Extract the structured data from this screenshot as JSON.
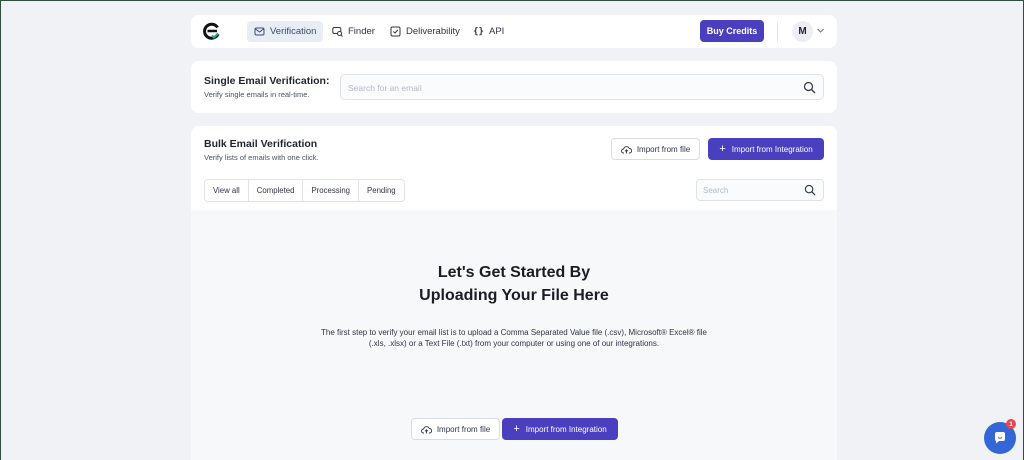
{
  "nav": {
    "links": [
      {
        "label": "Verification",
        "icon": "envelope-check-icon",
        "active": true
      },
      {
        "label": "Finder",
        "icon": "search-person-icon",
        "active": false
      },
      {
        "label": "Deliverability",
        "icon": "check-square-icon",
        "active": false
      },
      {
        "label": "API",
        "icon": "braces-icon",
        "active": false
      }
    ],
    "buy_credits": "Buy Credits",
    "avatar_initial": "M"
  },
  "single": {
    "title": "Single Email Verification:",
    "subtitle": "Verify single emails in real-time.",
    "search_placeholder": "Search for an email"
  },
  "bulk": {
    "title": "Bulk Email Verification",
    "subtitle": "Verify lists of emails with one click.",
    "import_file": "Import from file",
    "import_integration": "Import from Integration",
    "tabs": [
      "View all",
      "Completed",
      "Processing",
      "Pending"
    ],
    "search_placeholder": "Search",
    "empty": {
      "headline_line1": "Let's Get Started By",
      "headline_line2": "Uploading Your File Here",
      "description": "The first step to verify your email list is to upload a Comma Separated Value file (.csv), Microsoft® Excel® file (.xls, .xlsx) or a Text File (.txt) from your computer or using one of our integrations.",
      "import_file": "Import from file",
      "import_integration": "Import from Integration"
    }
  },
  "chat": {
    "badge_count": "1"
  },
  "colors": {
    "accent": "#4a3fbf",
    "background": "#f1f2f6",
    "chat": "#3366d6",
    "badge": "#e5484d"
  }
}
